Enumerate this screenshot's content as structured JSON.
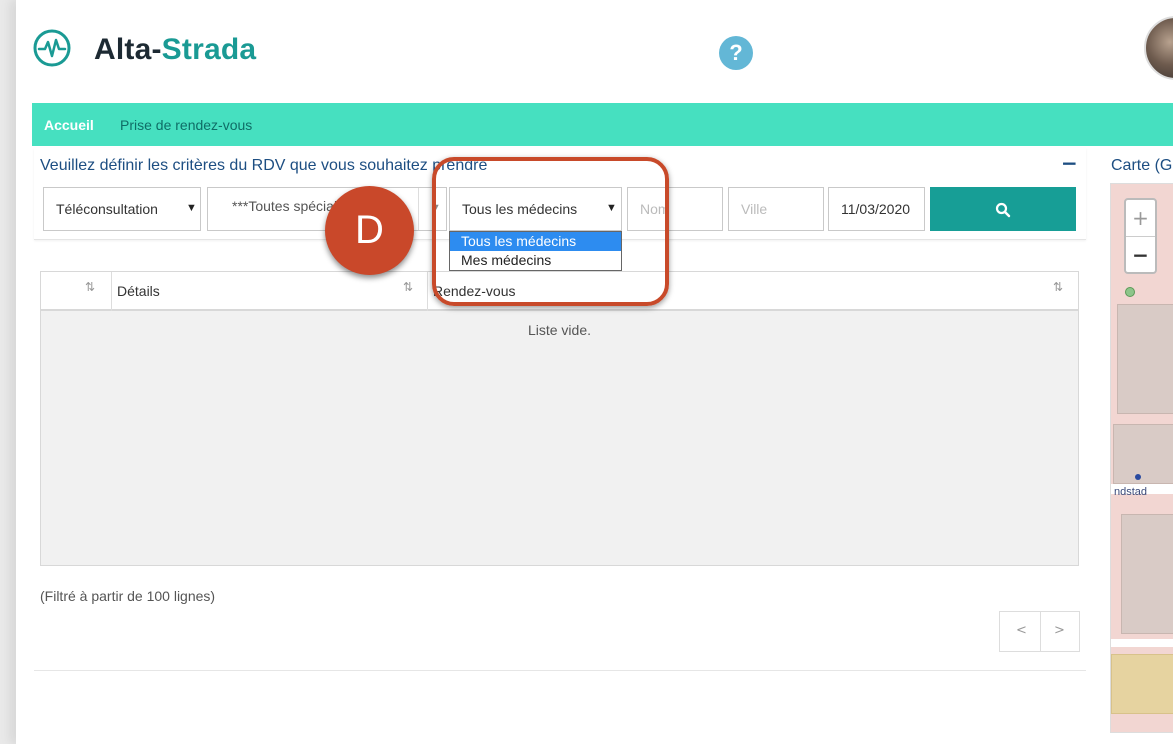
{
  "header": {
    "brand_part1": "Alta-",
    "brand_part2": "Strada",
    "help_glyph": "?"
  },
  "nav": {
    "items": [
      {
        "label": "Accueil",
        "active": true
      },
      {
        "label": "Prise de rendez-vous",
        "active": false
      }
    ]
  },
  "criteria": {
    "title": "Veuillez définir les critères du RDV que vous souhaitez prendre",
    "collapse_glyph": "−",
    "type_select": {
      "value": "Téléconsultation"
    },
    "speciality_select": {
      "value": "***Toutes spécialités***"
    },
    "doctor_select": {
      "value": "Tous les médecins",
      "options": [
        "Tous les médecins",
        "Mes médecins"
      ],
      "selected_index": 0
    },
    "name_input": {
      "placeholder": "Nom"
    },
    "city_input": {
      "placeholder": "Ville"
    },
    "date_input": {
      "value": "11/03/2020"
    }
  },
  "table": {
    "columns": [
      "Détails",
      "Rendez-vous"
    ],
    "empty_message": "Liste vide."
  },
  "filter_note": "(Filtré à partir de 100 lignes)",
  "pager": {
    "prev": "<",
    "next": ">"
  },
  "map": {
    "title": "Carte (G",
    "zoom_in": "+",
    "zoom_out": "−",
    "place_label": "ndstad"
  },
  "annotation": {
    "marker_label": "D",
    "color": "#c84a2a"
  },
  "colors": {
    "accent": "#46e0c0",
    "primary_button": "#179e96",
    "title_blue": "#1d4e82"
  }
}
